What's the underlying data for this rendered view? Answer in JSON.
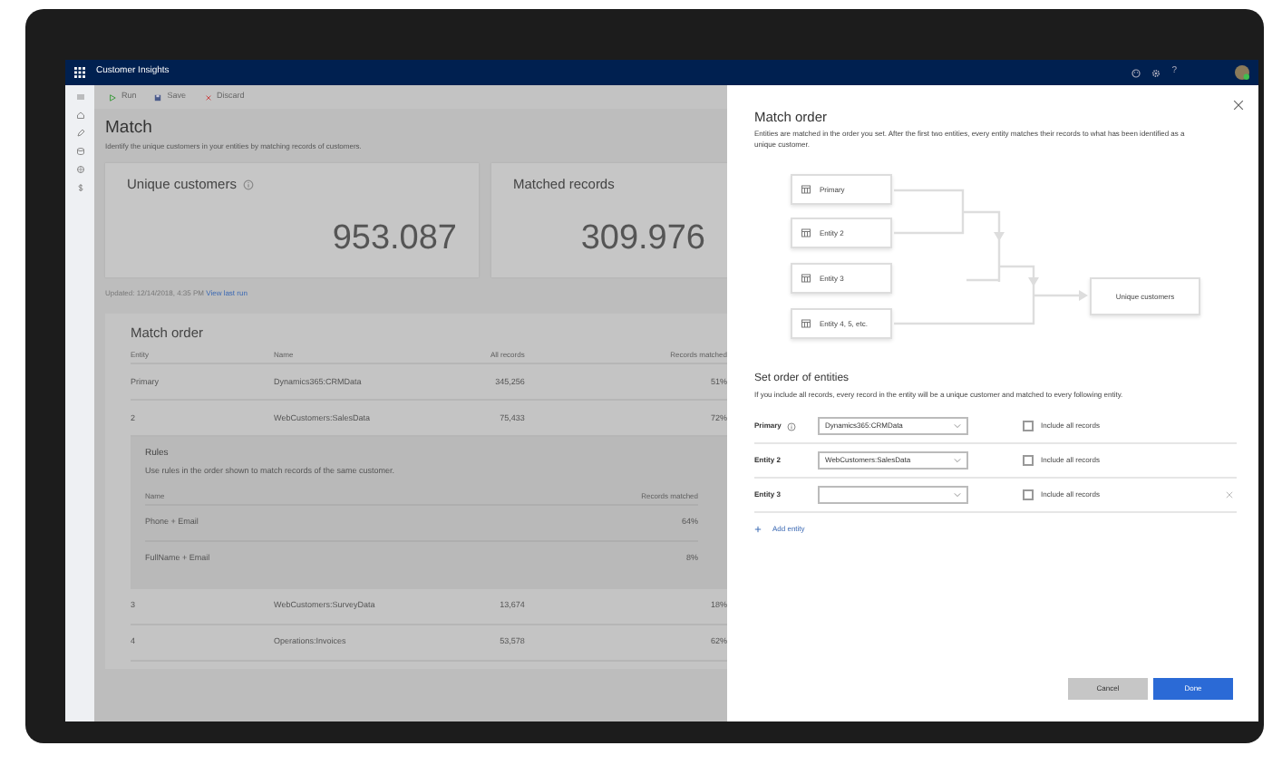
{
  "app": {
    "title": "Customer Insights",
    "help": "?"
  },
  "toolbar": [
    {
      "kind": "run",
      "label": "Run"
    },
    {
      "kind": "save",
      "label": "Save"
    },
    {
      "kind": "discard",
      "label": "Discard"
    }
  ],
  "page": {
    "title": "Match",
    "subtitle": "Identify the unique customers in your entities by matching records of customers."
  },
  "stats": [
    {
      "label": "Unique customers",
      "info": true,
      "value": "953.087"
    },
    {
      "label": "Matched records",
      "info": false,
      "value": "309.976"
    }
  ],
  "updated": {
    "text": "Updated: 12/14/2018, 4:35 PM",
    "link": "View last run"
  },
  "match_order": {
    "title": "Match order",
    "columns": [
      "Entity",
      "Name",
      "All records",
      "Records matched"
    ],
    "rows": [
      {
        "entity": "Primary",
        "name": "Dynamics365:CRMData",
        "all_records": "345,256",
        "matched": "51%"
      },
      {
        "entity": "2",
        "name": "WebCustomers:SalesData",
        "all_records": "75,433",
        "matched": "72%",
        "rules": {
          "title": "Rules",
          "description": "Use rules in the order shown to match records of the same customer.",
          "columns": [
            "Name",
            "Records matched"
          ],
          "rows": [
            {
              "name": "Phone + Email",
              "matched": "64%"
            },
            {
              "name": "FullName + Email",
              "matched": "8%"
            }
          ]
        }
      },
      {
        "entity": "3",
        "name": "WebCustomers:SurveyData",
        "all_records": "13,674",
        "matched": "18%"
      },
      {
        "entity": "4",
        "name": "Operations:Invoices",
        "all_records": "53,578",
        "matched": "62%"
      }
    ]
  },
  "panel": {
    "title": "Match order",
    "description": "Entities are matched in the order you set. After the first two entities, every entity matches their records to what has been identified as a unique customer.",
    "diagram": {
      "nodes": [
        "Primary",
        "Entity 2",
        "Entity 3",
        "Entity 4, 5, etc."
      ],
      "result": "Unique customers"
    },
    "set_order": {
      "title": "Set order of entities",
      "description": "If you include all records, every record in the entity will be a unique customer and matched to every following entity.",
      "rows": [
        {
          "label": "Primary",
          "info": true,
          "value": "Dynamics365:CRMData",
          "include_label": "Include all records",
          "checked": false,
          "removable": false
        },
        {
          "label": "Entity 2",
          "info": false,
          "value": "WebCustomers:SalesData",
          "include_label": "Include all records",
          "checked": false,
          "removable": false
        },
        {
          "label": "Entity 3",
          "info": false,
          "include_label": "Include all records",
          "checked": false,
          "removable": true
        }
      ]
    },
    "add_entity": "Add entity",
    "buttons": [
      {
        "kind": "secondary",
        "label": "Cancel"
      },
      {
        "kind": "primary",
        "label": "Done"
      }
    ]
  }
}
